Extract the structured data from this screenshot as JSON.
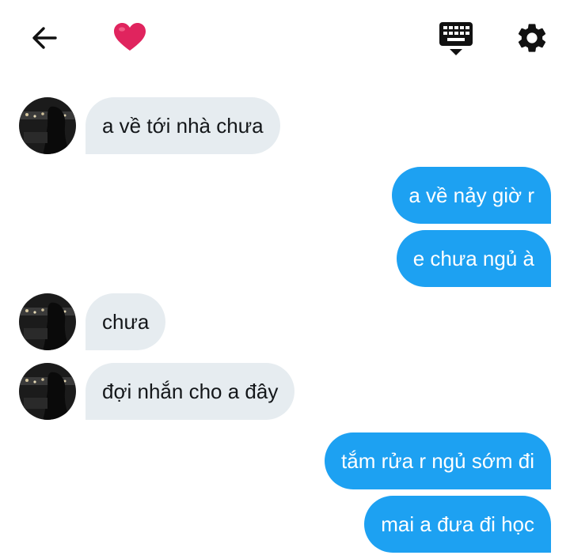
{
  "header": {
    "back_icon": "arrow-left-icon",
    "heart_icon": "red-heart-icon",
    "keyboard_icon": "keyboard-icon",
    "settings_icon": "gear-icon"
  },
  "messages": [
    {
      "direction": "incoming",
      "text": "a về tới nhà chưa"
    },
    {
      "direction": "outgoing",
      "text": "a về nảy giờ r"
    },
    {
      "direction": "outgoing",
      "text": "e chưa ngủ à"
    },
    {
      "direction": "incoming",
      "text": "chưa"
    },
    {
      "direction": "incoming",
      "text": "đợi nhắn cho a đây"
    },
    {
      "direction": "outgoing",
      "text": "tắm rửa r ngủ sớm đi"
    },
    {
      "direction": "outgoing",
      "text": "mai a đưa đi học"
    }
  ],
  "colors": {
    "incoming_bubble": "#e6ecf0",
    "outgoing_bubble": "#1da1f2",
    "heart": "#e0245e"
  }
}
